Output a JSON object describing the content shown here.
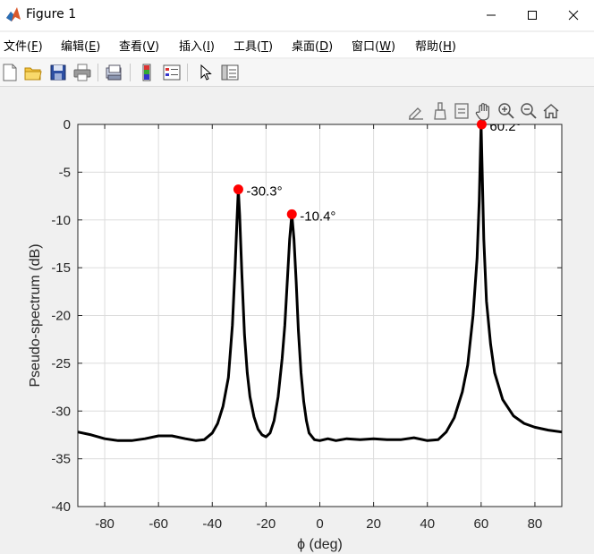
{
  "window": {
    "title": "Figure 1",
    "icon": "matlab-logo-icon"
  },
  "menu": [
    {
      "label": "文件(",
      "key": "F",
      "tail": ")"
    },
    {
      "label": "编辑(",
      "key": "E",
      "tail": ")"
    },
    {
      "label": "查看(",
      "key": "V",
      "tail": ")"
    },
    {
      "label": "插入(",
      "key": "I",
      "tail": ")"
    },
    {
      "label": "工具(",
      "key": "T",
      "tail": ")"
    },
    {
      "label": "桌面(",
      "key": "D",
      "tail": ")"
    },
    {
      "label": "窗口(",
      "key": "W",
      "tail": ")"
    },
    {
      "label": "帮助(",
      "key": "H",
      "tail": ")"
    }
  ],
  "toolbar_icons": [
    "new-figure-icon",
    "open-folder-icon",
    "save-icon",
    "print-icon",
    "export-icon",
    "colorbar-icon",
    "legend-icon",
    "pointer-icon",
    "property-inspector-icon"
  ],
  "axes_toolbar_icons": [
    "brush-edit-icon",
    "data-brush-icon",
    "data-tips-icon",
    "pan-hand-icon",
    "zoom-in-icon",
    "zoom-out-icon",
    "home-icon"
  ],
  "colors": {
    "line": "#000000",
    "marker": "#ff0000",
    "grid": "#dcdcdc",
    "axes_background": "#ffffff",
    "figure_background": "#f0f0f0"
  },
  "chart_data": {
    "type": "line",
    "xlabel": "ϕ (deg)",
    "ylabel": "Pseudo-spectrum (dB)",
    "xlim": [
      -90,
      90
    ],
    "ylim": [
      -40,
      0
    ],
    "xticks": [
      -80,
      -60,
      -40,
      -20,
      0,
      20,
      40,
      60,
      80
    ],
    "yticks": [
      0,
      -5,
      -10,
      -15,
      -20,
      -25,
      -30,
      -35,
      -40
    ],
    "grid": true,
    "series": [
      {
        "x": [
          -90,
          -85,
          -80,
          -75,
          -70,
          -65,
          -60,
          -55,
          -50,
          -46,
          -43,
          -40,
          -38,
          -36,
          -34,
          -32.5,
          -31.5,
          -30.8,
          -30.3,
          -29.8,
          -29,
          -28,
          -27,
          -26,
          -24.5,
          -23,
          -21.5,
          -20,
          -18.5,
          -17,
          -15.5,
          -14,
          -13,
          -12,
          -11.2,
          -10.4,
          -9.6,
          -8.8,
          -8,
          -7,
          -6,
          -5,
          -4,
          -2,
          0,
          3,
          6,
          10,
          15,
          20,
          25,
          30,
          35,
          40,
          44,
          47,
          50,
          53,
          55,
          57,
          58.5,
          59.3,
          60,
          60.5,
          61,
          62,
          63.5,
          65,
          68,
          72,
          76,
          80,
          85,
          90
        ],
        "y": [
          -32.2,
          -32.5,
          -32.9,
          -33.1,
          -33.1,
          -32.9,
          -32.6,
          -32.6,
          -32.9,
          -33.1,
          -33.0,
          -32.3,
          -31.3,
          -29.5,
          -26.5,
          -21.0,
          -15.0,
          -10.0,
          -6.8,
          -9.5,
          -15.5,
          -22.0,
          -26.0,
          -28.5,
          -30.6,
          -31.9,
          -32.5,
          -32.7,
          -32.3,
          -31.0,
          -28.5,
          -24.5,
          -21.0,
          -16.0,
          -12.0,
          -9.4,
          -12.0,
          -16.5,
          -21.5,
          -26.0,
          -29.0,
          -31.0,
          -32.3,
          -33.0,
          -33.1,
          -32.9,
          -33.1,
          -32.9,
          -33.0,
          -32.9,
          -33.0,
          -33.0,
          -32.8,
          -33.1,
          -33.0,
          -32.2,
          -30.7,
          -28.0,
          -25.2,
          -20.0,
          -14.0,
          -8.0,
          0.0,
          -6.0,
          -12.0,
          -18.5,
          -23.0,
          -26.0,
          -28.8,
          -30.5,
          -31.3,
          -31.7,
          -32.0,
          -32.2
        ]
      }
    ],
    "markers": [
      {
        "x": -30.3,
        "y": -6.8,
        "label": "-30.3°"
      },
      {
        "x": -10.4,
        "y": -9.4,
        "label": "-10.4°"
      },
      {
        "x": 60.2,
        "y": 0.0,
        "label": "60.2°"
      }
    ]
  }
}
